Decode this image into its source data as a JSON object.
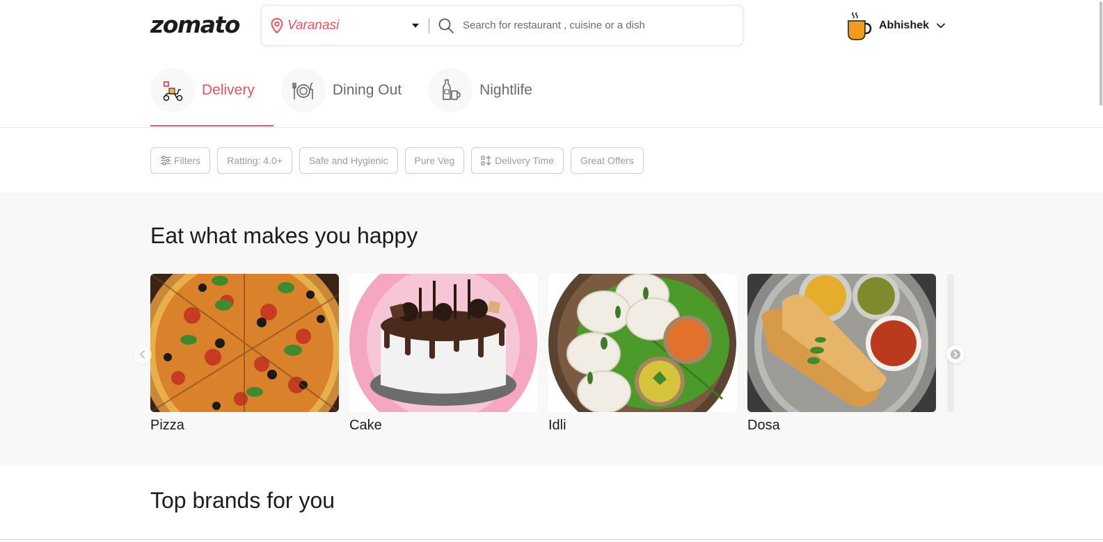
{
  "header": {
    "logo": "zomato",
    "location": "Varanasi",
    "search_placeholder": "Search for restaurant , cuisine or a dish",
    "user_name": "Abhishek"
  },
  "tabs": [
    {
      "label": "Delivery",
      "icon": "scooter-icon",
      "active": true
    },
    {
      "label": "Dining Out",
      "icon": "dining-icon",
      "active": false
    },
    {
      "label": "Nightlife",
      "icon": "nightlife-icon",
      "active": false
    }
  ],
  "filters": [
    {
      "label": "Filters",
      "icon": "sliders-icon"
    },
    {
      "label": "Ratting: 4.0+"
    },
    {
      "label": "Safe and Hygienic"
    },
    {
      "label": "Pure Veg"
    },
    {
      "label": "Delivery Time",
      "icon": "sort-icon"
    },
    {
      "label": "Great Offers"
    }
  ],
  "eat_section": {
    "title": "Eat what makes you happy",
    "items": [
      {
        "label": "Pizza"
      },
      {
        "label": "Cake"
      },
      {
        "label": "Idli"
      },
      {
        "label": "Dosa"
      }
    ]
  },
  "brands_section": {
    "title": "Top brands for you"
  },
  "colors": {
    "accent": "#ef4f5f",
    "section_bg": "#f8f8f8",
    "text": "#1c1c1c",
    "muted": "#696969"
  }
}
